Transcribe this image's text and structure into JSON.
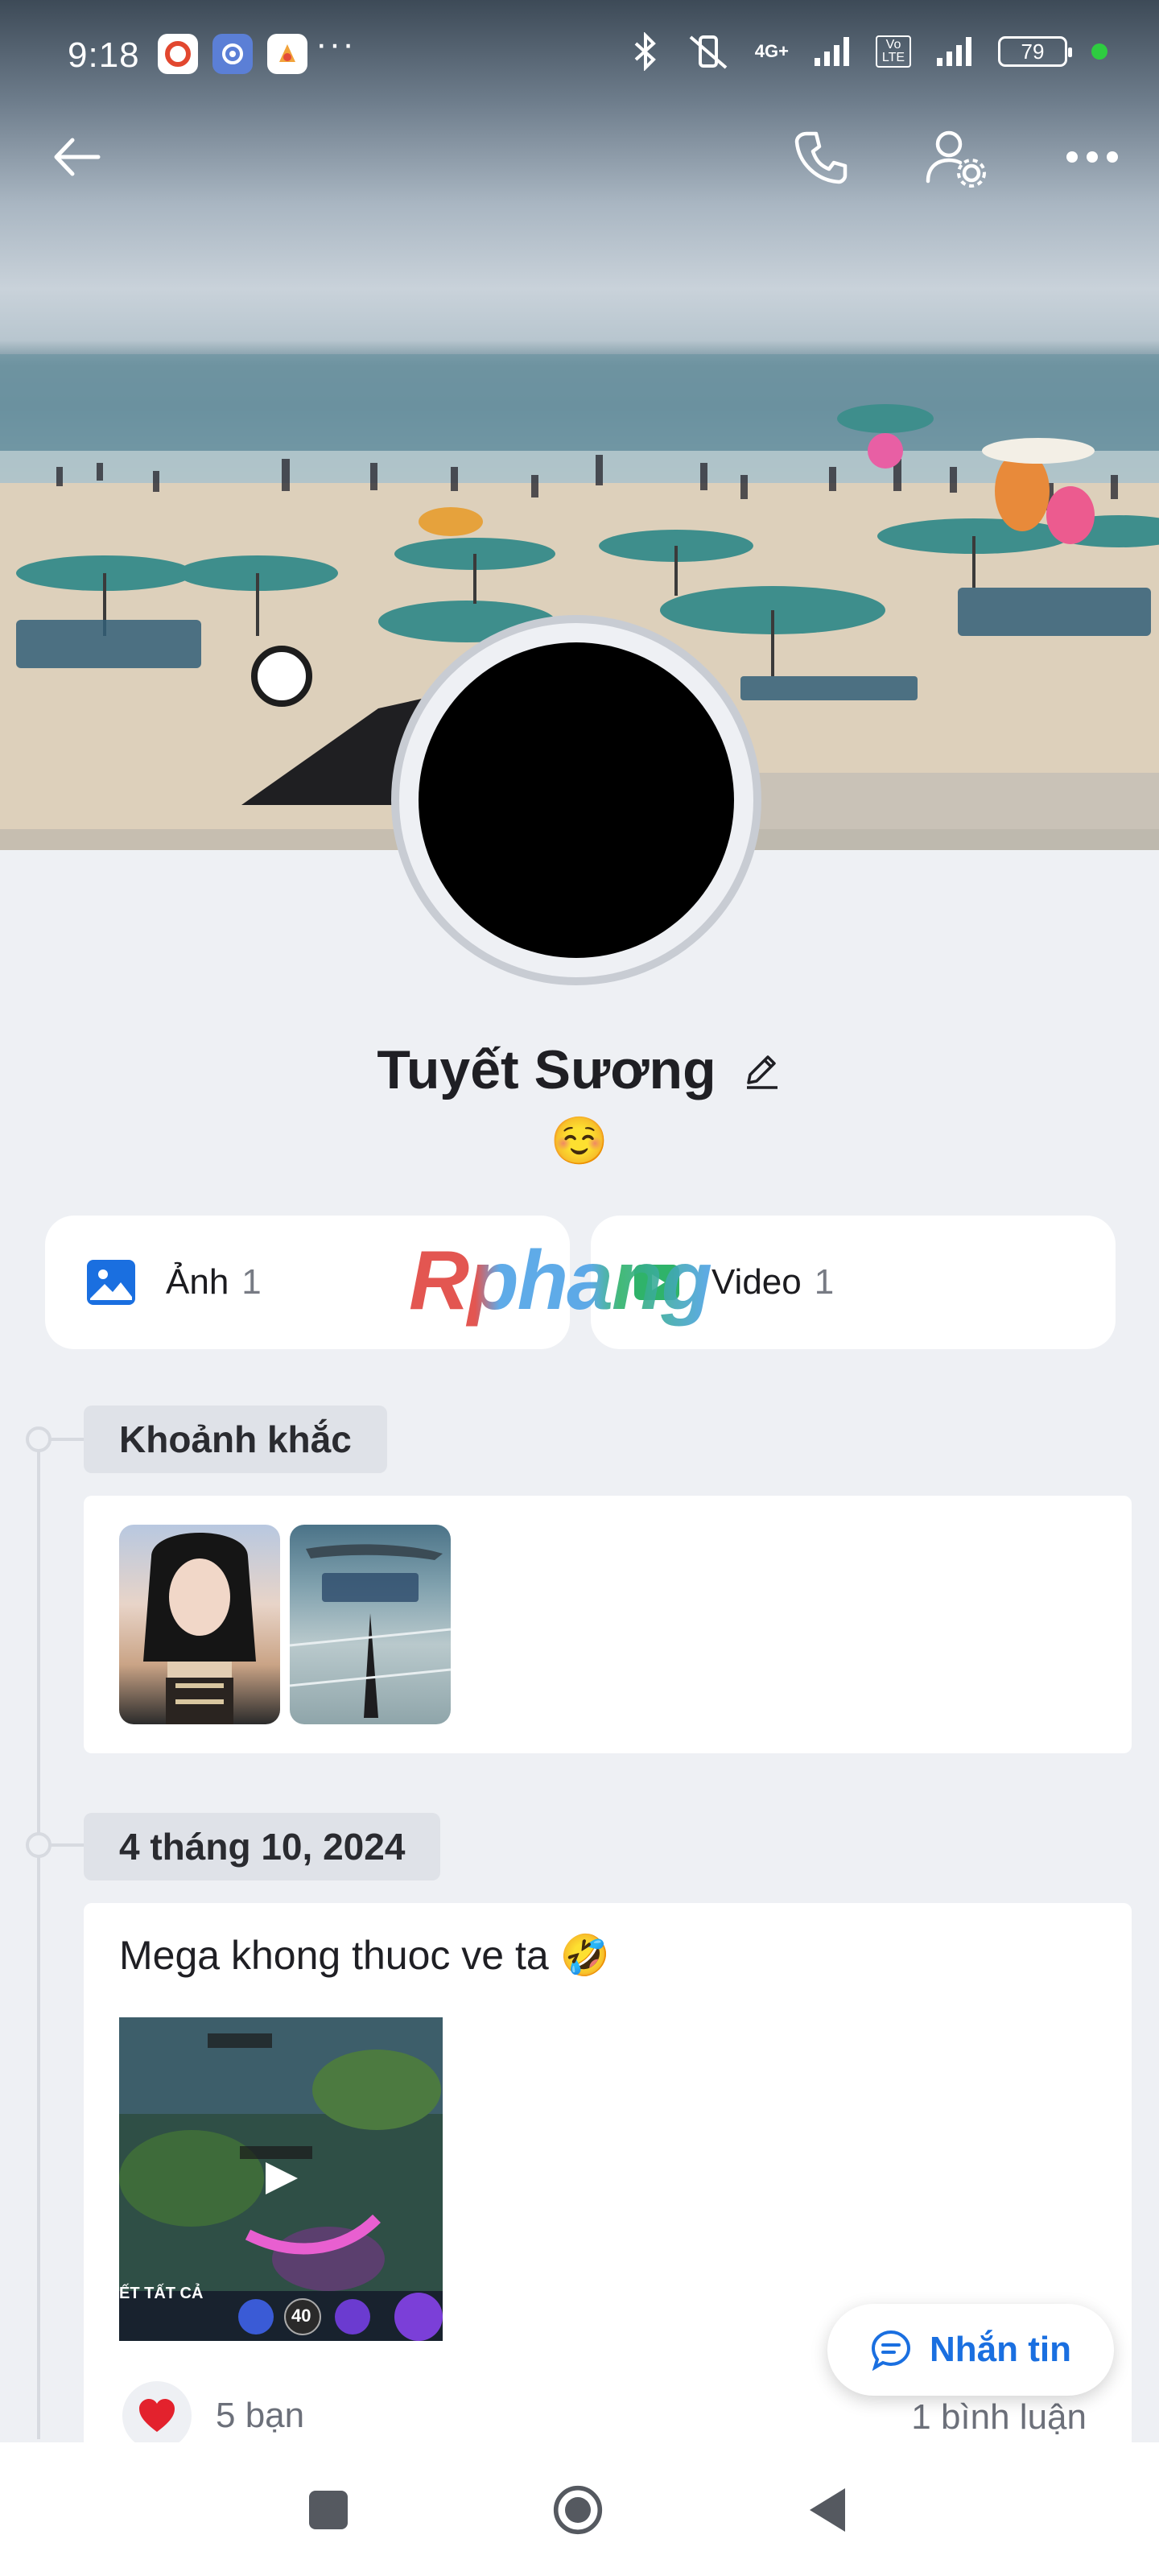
{
  "status_bar": {
    "time": "9:18",
    "more": "···",
    "battery": "79",
    "network": "4G+",
    "volte": "Vo LTE"
  },
  "header": {
    "back_icon": "arrow-left-icon",
    "call_icon": "phone-icon",
    "settings_icon": "user-settings-icon",
    "more_icon": "more-horizontal-icon"
  },
  "profile": {
    "name": "Tuyết Sương",
    "status_emoji": "☺️"
  },
  "media": {
    "photos_label": "Ảnh",
    "photos_count": "1",
    "videos_label": "Video",
    "videos_count": "1"
  },
  "watermark": "Rphang",
  "moments": {
    "title": "Khoảnh khắc"
  },
  "post": {
    "date": "4 tháng 10, 2024",
    "text": "Mega khong thuoc ve ta 🤣",
    "video_overlay_text": "ẾT TẤT CẢ",
    "video_level": "40",
    "reactions": "5 bạn",
    "comments": "1 bình luận"
  },
  "fab": {
    "label": "Nhắn tin"
  },
  "colors": {
    "accent": "#1a6fe0",
    "background": "#eef0f4",
    "card": "#ffffff",
    "chip": "#dfe2e8"
  }
}
